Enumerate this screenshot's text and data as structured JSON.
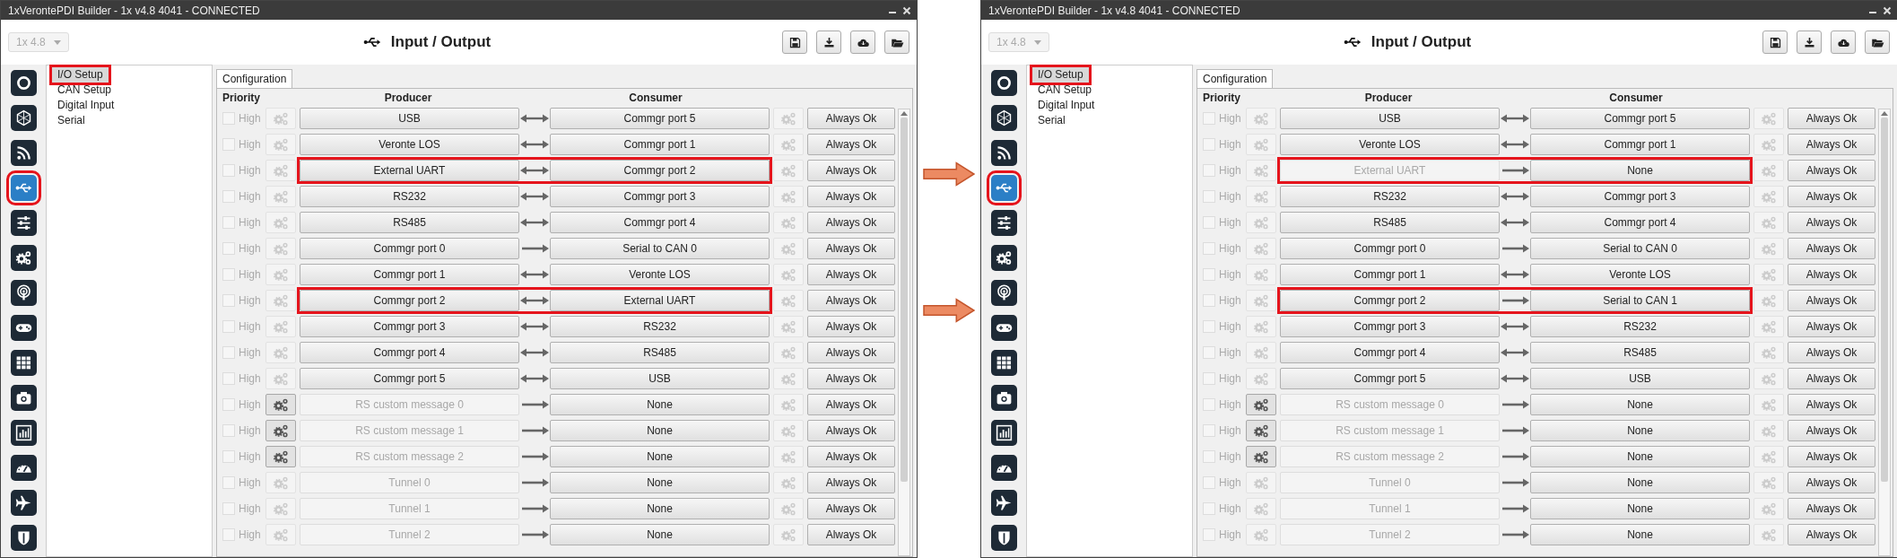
{
  "windows": [
    {
      "title": "1xVerontePDI Builder - 1x v4.8 4041 - CONNECTED",
      "version": "1x 4.8",
      "heading": "Input / Output",
      "nav": [
        {
          "selected": false,
          "highlighted": false
        },
        {
          "selected": false,
          "highlighted": false
        },
        {
          "selected": false,
          "highlighted": false
        },
        {
          "selected": true,
          "highlighted": true
        },
        {
          "selected": false,
          "highlighted": false
        },
        {
          "selected": false,
          "highlighted": false
        },
        {
          "selected": false,
          "highlighted": false
        },
        {
          "selected": false,
          "highlighted": false
        },
        {
          "selected": false,
          "highlighted": false
        },
        {
          "selected": false,
          "highlighted": false
        },
        {
          "selected": false,
          "highlighted": false
        },
        {
          "selected": false,
          "highlighted": false
        },
        {
          "selected": false,
          "highlighted": false
        },
        {
          "selected": false,
          "highlighted": false
        }
      ],
      "menu": [
        {
          "label": "I/O Setup",
          "selected": true,
          "highlighted": true
        },
        {
          "label": "CAN Setup",
          "selected": false,
          "highlighted": false
        },
        {
          "label": "Digital Input",
          "selected": false,
          "highlighted": false
        },
        {
          "label": "Serial",
          "selected": false,
          "highlighted": false
        }
      ],
      "tab": "Configuration",
      "columns": {
        "priority": "Priority",
        "producer": "Producer",
        "consumer": "Consumer"
      },
      "rows": [
        {
          "checked": false,
          "priority": "High",
          "producer_config_enabled": false,
          "producer": "USB",
          "producer_enabled": true,
          "bidirectional": true,
          "consumer": "Commgr port 5",
          "status": "Always Ok",
          "highlighted": false
        },
        {
          "checked": false,
          "priority": "High",
          "producer_config_enabled": false,
          "producer": "Veronte LOS",
          "producer_enabled": true,
          "bidirectional": true,
          "consumer": "Commgr port 1",
          "status": "Always Ok",
          "highlighted": false
        },
        {
          "checked": false,
          "priority": "High",
          "producer_config_enabled": false,
          "producer": "External UART",
          "producer_enabled": true,
          "bidirectional": true,
          "consumer": "Commgr port 2",
          "status": "Always Ok",
          "highlighted": true
        },
        {
          "checked": false,
          "priority": "High",
          "producer_config_enabled": false,
          "producer": "RS232",
          "producer_enabled": true,
          "bidirectional": true,
          "consumer": "Commgr port 3",
          "status": "Always Ok",
          "highlighted": false
        },
        {
          "checked": false,
          "priority": "High",
          "producer_config_enabled": false,
          "producer": "RS485",
          "producer_enabled": true,
          "bidirectional": true,
          "consumer": "Commgr port 4",
          "status": "Always Ok",
          "highlighted": false
        },
        {
          "checked": false,
          "priority": "High",
          "producer_config_enabled": false,
          "producer": "Commgr port 0",
          "producer_enabled": true,
          "bidirectional": false,
          "consumer": "Serial to CAN 0",
          "status": "Always Ok",
          "highlighted": false
        },
        {
          "checked": false,
          "priority": "High",
          "producer_config_enabled": false,
          "producer": "Commgr port 1",
          "producer_enabled": true,
          "bidirectional": true,
          "consumer": "Veronte LOS",
          "status": "Always Ok",
          "highlighted": false
        },
        {
          "checked": false,
          "priority": "High",
          "producer_config_enabled": false,
          "producer": "Commgr port 2",
          "producer_enabled": true,
          "bidirectional": true,
          "consumer": "External UART",
          "status": "Always Ok",
          "highlighted": true
        },
        {
          "checked": false,
          "priority": "High",
          "producer_config_enabled": false,
          "producer": "Commgr port 3",
          "producer_enabled": true,
          "bidirectional": true,
          "consumer": "RS232",
          "status": "Always Ok",
          "highlighted": false
        },
        {
          "checked": false,
          "priority": "High",
          "producer_config_enabled": false,
          "producer": "Commgr port 4",
          "producer_enabled": true,
          "bidirectional": true,
          "consumer": "RS485",
          "status": "Always Ok",
          "highlighted": false
        },
        {
          "checked": false,
          "priority": "High",
          "producer_config_enabled": false,
          "producer": "Commgr port 5",
          "producer_enabled": true,
          "bidirectional": true,
          "consumer": "USB",
          "status": "Always Ok",
          "highlighted": false
        },
        {
          "checked": false,
          "priority": "High",
          "producer_config_enabled": true,
          "producer": "RS custom message 0",
          "producer_enabled": false,
          "bidirectional": false,
          "consumer": "None",
          "status": "Always Ok",
          "highlighted": false
        },
        {
          "checked": false,
          "priority": "High",
          "producer_config_enabled": true,
          "producer": "RS custom message 1",
          "producer_enabled": false,
          "bidirectional": false,
          "consumer": "None",
          "status": "Always Ok",
          "highlighted": false
        },
        {
          "checked": false,
          "priority": "High",
          "producer_config_enabled": true,
          "producer": "RS custom message 2",
          "producer_enabled": false,
          "bidirectional": false,
          "consumer": "None",
          "status": "Always Ok",
          "highlighted": false
        },
        {
          "checked": false,
          "priority": "High",
          "producer_config_enabled": false,
          "producer": "Tunnel 0",
          "producer_enabled": false,
          "bidirectional": false,
          "consumer": "None",
          "status": "Always Ok",
          "highlighted": false
        },
        {
          "checked": false,
          "priority": "High",
          "producer_config_enabled": false,
          "producer": "Tunnel 1",
          "producer_enabled": false,
          "bidirectional": false,
          "consumer": "None",
          "status": "Always Ok",
          "highlighted": false
        },
        {
          "checked": false,
          "priority": "High",
          "producer_config_enabled": false,
          "producer": "Tunnel 2",
          "producer_enabled": false,
          "bidirectional": false,
          "consumer": "None",
          "status": "Always Ok",
          "highlighted": false
        }
      ]
    },
    {
      "title": "1xVerontePDI Builder - 1x v4.8 4041 - CONNECTED",
      "version": "1x 4.8",
      "heading": "Input / Output",
      "nav": [
        {
          "selected": false,
          "highlighted": false
        },
        {
          "selected": false,
          "highlighted": false
        },
        {
          "selected": false,
          "highlighted": false
        },
        {
          "selected": true,
          "highlighted": true
        },
        {
          "selected": false,
          "highlighted": false
        },
        {
          "selected": false,
          "highlighted": false
        },
        {
          "selected": false,
          "highlighted": false
        },
        {
          "selected": false,
          "highlighted": false
        },
        {
          "selected": false,
          "highlighted": false
        },
        {
          "selected": false,
          "highlighted": false
        },
        {
          "selected": false,
          "highlighted": false
        },
        {
          "selected": false,
          "highlighted": false
        },
        {
          "selected": false,
          "highlighted": false
        },
        {
          "selected": false,
          "highlighted": false
        }
      ],
      "menu": [
        {
          "label": "I/O Setup",
          "selected": true,
          "highlighted": true
        },
        {
          "label": "CAN Setup",
          "selected": false,
          "highlighted": false
        },
        {
          "label": "Digital Input",
          "selected": false,
          "highlighted": false
        },
        {
          "label": "Serial",
          "selected": false,
          "highlighted": false
        }
      ],
      "tab": "Configuration",
      "columns": {
        "priority": "Priority",
        "producer": "Producer",
        "consumer": "Consumer"
      },
      "rows": [
        {
          "checked": false,
          "priority": "High",
          "producer_config_enabled": false,
          "producer": "USB",
          "producer_enabled": true,
          "bidirectional": true,
          "consumer": "Commgr port 5",
          "status": "Always Ok",
          "highlighted": false
        },
        {
          "checked": false,
          "priority": "High",
          "producer_config_enabled": false,
          "producer": "Veronte LOS",
          "producer_enabled": true,
          "bidirectional": true,
          "consumer": "Commgr port 1",
          "status": "Always Ok",
          "highlighted": false
        },
        {
          "checked": false,
          "priority": "High",
          "producer_config_enabled": false,
          "producer": "External UART",
          "producer_enabled": false,
          "bidirectional": false,
          "consumer": "None",
          "status": "Always Ok",
          "highlighted": true
        },
        {
          "checked": false,
          "priority": "High",
          "producer_config_enabled": false,
          "producer": "RS232",
          "producer_enabled": true,
          "bidirectional": true,
          "consumer": "Commgr port 3",
          "status": "Always Ok",
          "highlighted": false
        },
        {
          "checked": false,
          "priority": "High",
          "producer_config_enabled": false,
          "producer": "RS485",
          "producer_enabled": true,
          "bidirectional": true,
          "consumer": "Commgr port 4",
          "status": "Always Ok",
          "highlighted": false
        },
        {
          "checked": false,
          "priority": "High",
          "producer_config_enabled": false,
          "producer": "Commgr port 0",
          "producer_enabled": true,
          "bidirectional": false,
          "consumer": "Serial to CAN 0",
          "status": "Always Ok",
          "highlighted": false
        },
        {
          "checked": false,
          "priority": "High",
          "producer_config_enabled": false,
          "producer": "Commgr port 1",
          "producer_enabled": true,
          "bidirectional": true,
          "consumer": "Veronte LOS",
          "status": "Always Ok",
          "highlighted": false
        },
        {
          "checked": false,
          "priority": "High",
          "producer_config_enabled": false,
          "producer": "Commgr port 2",
          "producer_enabled": true,
          "bidirectional": false,
          "consumer": "Serial to CAN 1",
          "status": "Always Ok",
          "highlighted": true
        },
        {
          "checked": false,
          "priority": "High",
          "producer_config_enabled": false,
          "producer": "Commgr port 3",
          "producer_enabled": true,
          "bidirectional": true,
          "consumer": "RS232",
          "status": "Always Ok",
          "highlighted": false
        },
        {
          "checked": false,
          "priority": "High",
          "producer_config_enabled": false,
          "producer": "Commgr port 4",
          "producer_enabled": true,
          "bidirectional": true,
          "consumer": "RS485",
          "status": "Always Ok",
          "highlighted": false
        },
        {
          "checked": false,
          "priority": "High",
          "producer_config_enabled": false,
          "producer": "Commgr port 5",
          "producer_enabled": true,
          "bidirectional": true,
          "consumer": "USB",
          "status": "Always Ok",
          "highlighted": false
        },
        {
          "checked": false,
          "priority": "High",
          "producer_config_enabled": true,
          "producer": "RS custom message 0",
          "producer_enabled": false,
          "bidirectional": false,
          "consumer": "None",
          "status": "Always Ok",
          "highlighted": false
        },
        {
          "checked": false,
          "priority": "High",
          "producer_config_enabled": true,
          "producer": "RS custom message 1",
          "producer_enabled": false,
          "bidirectional": false,
          "consumer": "None",
          "status": "Always Ok",
          "highlighted": false
        },
        {
          "checked": false,
          "priority": "High",
          "producer_config_enabled": true,
          "producer": "RS custom message 2",
          "producer_enabled": false,
          "bidirectional": false,
          "consumer": "None",
          "status": "Always Ok",
          "highlighted": false
        },
        {
          "checked": false,
          "priority": "High",
          "producer_config_enabled": false,
          "producer": "Tunnel 0",
          "producer_enabled": false,
          "bidirectional": false,
          "consumer": "None",
          "status": "Always Ok",
          "highlighted": false
        },
        {
          "checked": false,
          "priority": "High",
          "producer_config_enabled": false,
          "producer": "Tunnel 1",
          "producer_enabled": false,
          "bidirectional": false,
          "consumer": "None",
          "status": "Always Ok",
          "highlighted": false
        },
        {
          "checked": false,
          "priority": "High",
          "producer_config_enabled": false,
          "producer": "Tunnel 2",
          "producer_enabled": false,
          "bidirectional": false,
          "consumer": "None",
          "status": "Always Ok",
          "highlighted": false
        }
      ]
    }
  ],
  "pointers": [
    {
      "kind": "arrow"
    },
    {
      "kind": "arrow"
    }
  ]
}
